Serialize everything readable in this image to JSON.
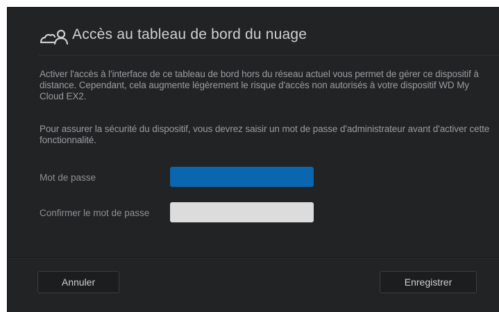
{
  "dialog": {
    "title": "Accès au tableau de bord du nuage",
    "title_icon": "cloud-user-icon",
    "paragraph1": "Activer l'accès à l'interface de ce tableau de bord hors du réseau actuel vous permet de gérer ce dispositif à distance. Cependant, cela augmente légèrement le risque d'accès non autorisés à votre dispositif WD My Cloud EX2.",
    "paragraph2": "Pour assurer la sécurité du dispositif, vous devrez saisir un mot de passe d'administrateur avant d'activer cette fonctionnalité."
  },
  "form": {
    "password_label": "Mot de passe",
    "password_value": "",
    "confirm_label": "Confirmer le mot de passe",
    "confirm_value": ""
  },
  "footer": {
    "cancel_label": "Annuler",
    "save_label": "Enregistrer"
  },
  "colors": {
    "background": "#222325",
    "active_input": "#0a66ae",
    "inactive_input": "#dcdcdc",
    "text": "#9b9c9f"
  }
}
